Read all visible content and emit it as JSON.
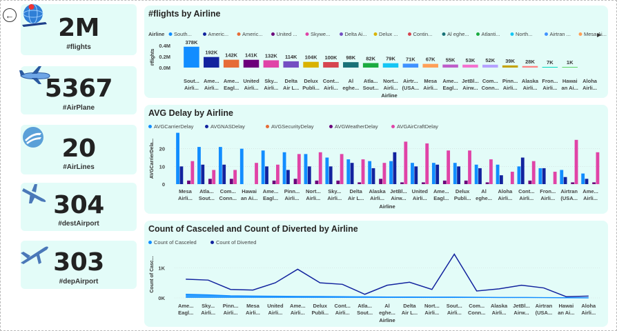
{
  "kpis": [
    {
      "value": "2M",
      "label": "#flights",
      "icon": "globe-plane-icon"
    },
    {
      "value": "5367",
      "label": "#AirPlane",
      "icon": "airplane-icon"
    },
    {
      "value": "20",
      "label": "#AirLines",
      "icon": "airline-logo-icon"
    },
    {
      "value": "304",
      "label": "#destAirport",
      "icon": "landing-plane-icon"
    },
    {
      "value": "303",
      "label": "#depAirport",
      "icon": "takeoff-plane-icon"
    }
  ],
  "colors": {
    "panel_bg": "#e3fcf8",
    "palette": [
      "#118dff",
      "#12239e",
      "#e66c37",
      "#6b007b",
      "#e044a7",
      "#744ec2",
      "#d9b300",
      "#d64550",
      "#197278",
      "#1aab40",
      "#15c6f4",
      "#4092ff",
      "#ffa058",
      "#be5dc9",
      "#f472d0",
      "#b5a1ff",
      "#c4a200",
      "#ff8080",
      "#00dbbc",
      "#5bd667"
    ]
  },
  "chart_data": [
    {
      "type": "bar",
      "title": "#flights by Airline",
      "legend_title": "Airline",
      "legend": [
        "South...",
        "Americ...",
        "Americ...",
        "United ...",
        "Skywe...",
        "Delta Ai...",
        "Delux ...",
        "Contin...",
        "Al eghe...",
        "Atlanti...",
        "North...",
        "Airtran ...",
        "Mesa Ai..."
      ],
      "xlabel": "Airline",
      "ylabel": "#flights",
      "yticks": [
        "0.0M",
        "0.2M",
        "0.4M"
      ],
      "ylim": [
        0,
        400000
      ],
      "categories": [
        [
          "Sout...",
          "Airli..."
        ],
        [
          "Ame...",
          "Airli..."
        ],
        [
          "Ame...",
          "Eagl..."
        ],
        [
          "United",
          "Airli..."
        ],
        [
          "Sky...",
          "Airli..."
        ],
        [
          "Delta",
          "Air L..."
        ],
        [
          "Delux",
          "Publi..."
        ],
        [
          "Cont...",
          "Airli..."
        ],
        [
          "Al",
          "eghe..."
        ],
        [
          "Atla...",
          "Sout..."
        ],
        [
          "Nort...",
          "Airli..."
        ],
        [
          "Airtr...",
          "(USA..."
        ],
        [
          "Mesa",
          "Airli..."
        ],
        [
          "Ame...",
          "Eagl..."
        ],
        [
          "JetBl...",
          "Airw..."
        ],
        [
          "Com...",
          "Conn..."
        ],
        [
          "Pinn...",
          "Airli..."
        ],
        [
          "Alaska",
          "Airli..."
        ],
        [
          "Fron...",
          "Airli..."
        ],
        [
          "Hawai",
          "an Ai..."
        ],
        [
          "Aloha",
          "Airli..."
        ]
      ],
      "values": [
        378000,
        192000,
        142000,
        141000,
        132000,
        114000,
        104000,
        100000,
        98000,
        82000,
        79000,
        71000,
        67000,
        55000,
        53000,
        52000,
        39000,
        28000,
        7000,
        1000
      ],
      "labels": [
        "378K",
        "192K",
        "142K",
        "141K",
        "132K",
        "114K",
        "104K",
        "100K",
        "98K",
        "82K",
        "79K",
        "71K",
        "67K",
        "55K",
        "53K",
        "52K",
        "39K",
        "28K",
        "7K",
        "1K"
      ]
    },
    {
      "type": "bar",
      "title": "AVG Delay by Airline",
      "xlabel": "Airline",
      "ylabel": "AVGCarrierDela...",
      "yticks": [
        "0",
        "10",
        "20"
      ],
      "ylim": [
        0,
        30
      ],
      "categories": [
        [
          "Mesa",
          "Airli..."
        ],
        [
          "Atla...",
          "Sout..."
        ],
        [
          "Com...",
          "Conn..."
        ],
        [
          "Hawai",
          "an Ai..."
        ],
        [
          "Ame...",
          "Eagl..."
        ],
        [
          "Pinn...",
          "Airli..."
        ],
        [
          "Nort...",
          "Airli..."
        ],
        [
          "Sky...",
          "Airli..."
        ],
        [
          "Delta",
          "Air L..."
        ],
        [
          "Alaska",
          "Airli..."
        ],
        [
          "JetBl...",
          "Airw..."
        ],
        [
          "United",
          "Airli..."
        ],
        [
          "Ame...",
          "Eagl..."
        ],
        [
          "Delux",
          "Publi..."
        ],
        [
          "Al",
          "eghe..."
        ],
        [
          "Aloha",
          "Airli..."
        ],
        [
          "Cont...",
          "Airli..."
        ],
        [
          "Fron...",
          "Airli..."
        ],
        [
          "Airtran",
          "(USA..."
        ],
        [
          "Ame...",
          "Airli..."
        ]
      ],
      "series": [
        {
          "name": "AVGCarrierDelay",
          "color": "#118dff",
          "values": [
            29,
            21,
            21,
            20,
            19,
            18,
            17,
            15,
            14,
            13,
            13,
            12,
            12,
            12,
            11,
            11,
            10,
            9,
            8,
            6
          ]
        },
        {
          "name": "AVGNASDelay",
          "color": "#12239e",
          "values": [
            10,
            11,
            11,
            0,
            10,
            8,
            10,
            10,
            12,
            9,
            18,
            10,
            11,
            10,
            9,
            5,
            15,
            9,
            4,
            3
          ]
        },
        {
          "name": "AVGSecurityDelay",
          "color": "#e66c37",
          "values": [
            0,
            0,
            0,
            0,
            0,
            0,
            0,
            0,
            0,
            0,
            0,
            0,
            0,
            0,
            0,
            0,
            0,
            0,
            0,
            0
          ]
        },
        {
          "name": "AVGWeatherDelay",
          "color": "#6b007b",
          "values": [
            2,
            3,
            3,
            0,
            2,
            3,
            2,
            2,
            1,
            3,
            1,
            1,
            2,
            2,
            1,
            0,
            2,
            0,
            1,
            1
          ]
        },
        {
          "name": "AVGAirCraftDelay",
          "color": "#e044a7",
          "values": [
            13,
            8,
            8,
            12,
            11,
            17,
            18,
            17,
            14,
            12,
            24,
            23,
            19,
            19,
            14,
            7,
            13,
            7,
            25,
            18
          ]
        }
      ]
    },
    {
      "type": "area",
      "title": "Count of Casceled and Count of Diverted by Airline",
      "xlabel": "Airline",
      "ylabel": "Count of Casc...",
      "yticks": [
        "0K",
        "1K"
      ],
      "ylim": [
        0,
        1600
      ],
      "categories": [
        [
          "Ame...",
          "Eagl..."
        ],
        [
          "Sky...",
          "Airli..."
        ],
        [
          "Pinn...",
          "Airli..."
        ],
        [
          "Mesa",
          "Airli..."
        ],
        [
          "United",
          "Airli..."
        ],
        [
          "Ame...",
          "Airli..."
        ],
        [
          "Delux",
          "Publi..."
        ],
        [
          "Cont...",
          "Airli..."
        ],
        [
          "Atla...",
          "Sout..."
        ],
        [
          "Al",
          "eghe..."
        ],
        [
          "Delta",
          "Air L..."
        ],
        [
          "Nort...",
          "Airli..."
        ],
        [
          "Sout...",
          "Airli..."
        ],
        [
          "Com...",
          "Conn..."
        ],
        [
          "Alaska",
          "Airli..."
        ],
        [
          "JetBl...",
          "Airw..."
        ],
        [
          "Airtran",
          "(USA..."
        ],
        [
          "Hawai",
          "an Ai..."
        ],
        [
          "Aloha",
          "Airli..."
        ]
      ],
      "series": [
        {
          "name": "Count of Casceled",
          "color": "#118dff",
          "values": [
            120,
            100,
            70,
            60,
            55,
            50,
            45,
            40,
            35,
            30,
            30,
            25,
            25,
            20,
            15,
            15,
            10,
            5,
            3
          ]
        },
        {
          "name": "Count of Diverted",
          "color": "#12239e",
          "values": [
            620,
            590,
            280,
            260,
            500,
            950,
            500,
            450,
            120,
            420,
            520,
            280,
            1450,
            230,
            300,
            420,
            330,
            40,
            60
          ]
        }
      ]
    }
  ]
}
